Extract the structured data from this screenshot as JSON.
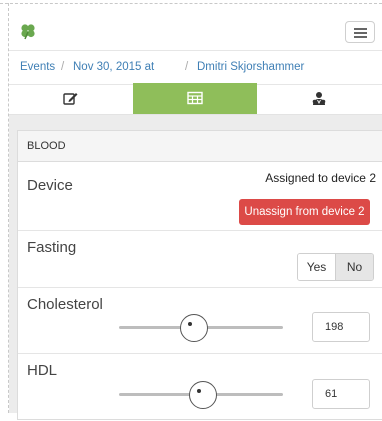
{
  "breadcrumb": {
    "events": "Events",
    "event_date": "Nov 30, 2015 at",
    "patient": "Dmitri Skjorshammer",
    "separator": "/"
  },
  "tabs": [
    {
      "icon": "edit-icon",
      "active": false
    },
    {
      "icon": "table-icon",
      "active": true
    },
    {
      "icon": "users-icon",
      "active": false
    }
  ],
  "panel": {
    "header": "BLOOD",
    "device": {
      "label": "Device",
      "status": "Assigned to device 2",
      "unassign_button": "Unassign from device 2"
    },
    "fasting": {
      "label": "Fasting",
      "yes": "Yes",
      "no": "No",
      "selected": "No"
    },
    "cholesterol": {
      "label": "Cholesterol",
      "value": "198",
      "slider_fraction": 0.46
    },
    "hdl": {
      "label": "HDL",
      "value": "61",
      "slider_fraction": 0.51
    }
  },
  "colors": {
    "active_tab": "#8fbe5a",
    "danger": "#dc4a47",
    "link": "#3f7fb5",
    "logo": "#6aa84f"
  }
}
